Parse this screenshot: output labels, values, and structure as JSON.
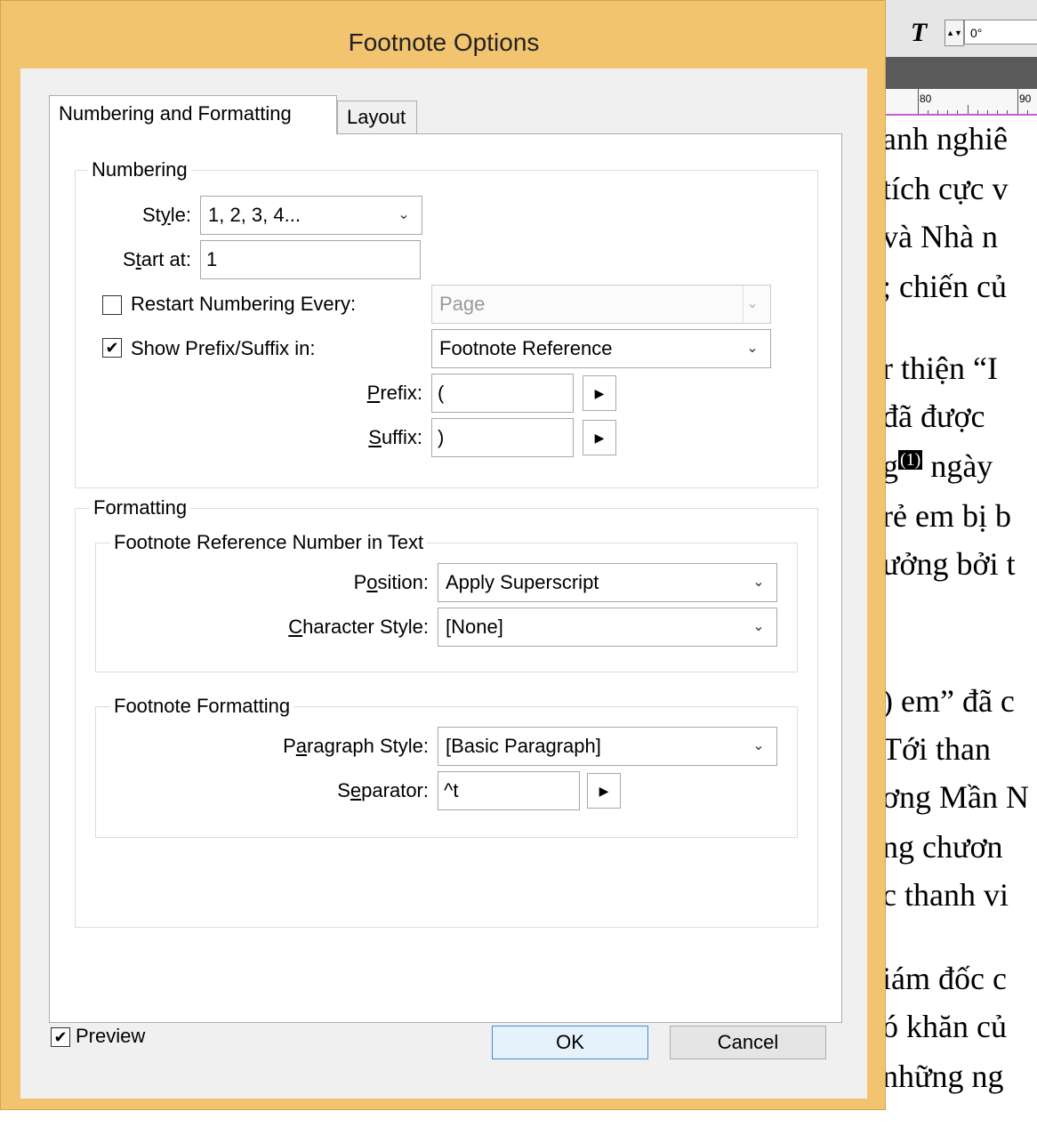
{
  "background": {
    "rotation_value": "0°",
    "type_tool_glyph": "T",
    "ruler_numbers": [
      "80",
      "90"
    ],
    "document_lines": [
      "anh nghiê",
      "tích cực v",
      "và Nhà n",
      "; chiến củ",
      "r thiện “I",
      "đã được",
      "ngày",
      "rẻ em bị b",
      "ưởng bởi t",
      ") em” đã c",
      "Tới than",
      "ơng Mần N",
      "ng chươn",
      "c thanh vi",
      "iám đốc c",
      "ó khăn củ",
      "những ng"
    ],
    "footnote_marker_prefix": "g",
    "footnote_marker": "(1)"
  },
  "dialog": {
    "title": "Footnote Options",
    "tabs": [
      {
        "label": "Numbering and Formatting",
        "active": true
      },
      {
        "label": "Layout",
        "active": false
      }
    ],
    "numbering": {
      "legend": "Numbering",
      "style_label_pre": "St",
      "style_label_u": "y",
      "style_label_post": "le:",
      "style_value": "1, 2, 3, 4...",
      "start_label_pre": "S",
      "start_label_u": "t",
      "start_label_post": "art at:",
      "start_value": "1",
      "restart_label": "Restart Numbering Every:",
      "restart_checked": false,
      "restart_value": "Page",
      "show_prefix_label": "Show Prefix/Suffix in:",
      "show_prefix_checked": true,
      "show_prefix_value": "Footnote Reference",
      "prefix_label_u": "P",
      "prefix_label_post": "refix:",
      "prefix_value": "(",
      "suffix_label_u": "S",
      "suffix_label_post": "uffix:",
      "suffix_value": ")"
    },
    "formatting": {
      "legend": "Formatting",
      "reference_group": {
        "legend": "Footnote Reference Number in Text",
        "position_label_pre": "P",
        "position_label_u": "o",
        "position_label_post": "sition:",
        "position_value": "Apply Superscript",
        "char_style_label_u": "C",
        "char_style_label_post": "haracter Style:",
        "char_style_value": "[None]"
      },
      "footnote_group": {
        "legend": "Footnote Formatting",
        "para_style_label_pre": "P",
        "para_style_label_u": "a",
        "para_style_label_post": "ragraph Style:",
        "para_style_value": "[Basic Paragraph]",
        "separator_label_pre": "S",
        "separator_label_u": "e",
        "separator_label_post": "parator:",
        "separator_value": "^t"
      }
    },
    "preview_label": "Preview",
    "preview_checked": true,
    "ok_label": "OK",
    "cancel_label": "Cancel"
  },
  "glyphs": {
    "check": "✔",
    "dropdown": "⌄",
    "flyout_arrow": "▶",
    "spin": "▲▼"
  },
  "colors": {
    "title_bar": "#f2c46f",
    "dialog_body": "#f0f0f0",
    "panel": "#ffffff",
    "default_button_border": "#3c8fd8",
    "guide": "#c95ad6"
  }
}
